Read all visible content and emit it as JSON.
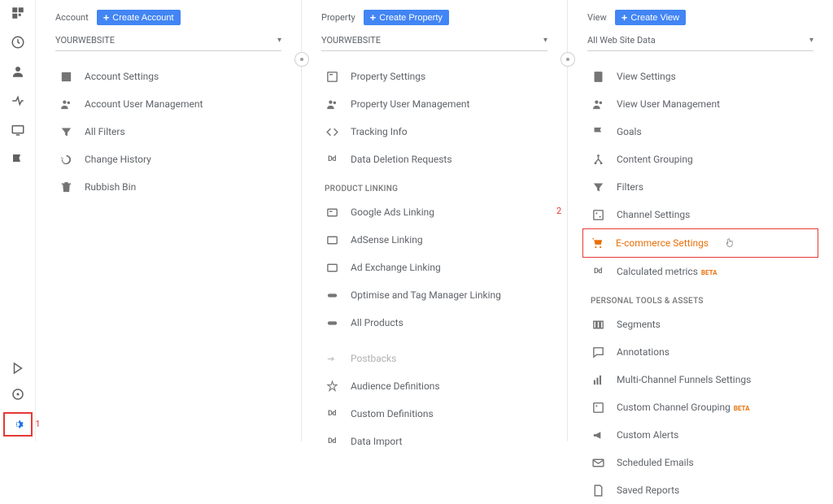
{
  "annotations": {
    "admin_gear": "1",
    "ecommerce": "2"
  },
  "sidebar_icons": [
    "home",
    "clock",
    "user",
    "arrows",
    "screen",
    "flag"
  ],
  "account": {
    "header_label": "Account",
    "create_btn": "Create Account",
    "selector": "YOURWEBSITE",
    "items": [
      {
        "label": "Account Settings"
      },
      {
        "label": "Account User Management"
      },
      {
        "label": "All Filters"
      },
      {
        "label": "Change History"
      },
      {
        "label": "Rubbish Bin"
      }
    ]
  },
  "property": {
    "header_label": "Property",
    "create_btn": "Create Property",
    "selector": "YOURWEBSITE",
    "items": [
      {
        "label": "Property Settings"
      },
      {
        "label": "Property User Management"
      },
      {
        "label": "Tracking Info"
      },
      {
        "label": "Data Deletion Requests"
      }
    ],
    "section_linking": "PRODUCT LINKING",
    "linking_items": [
      {
        "label": "Google Ads Linking"
      },
      {
        "label": "AdSense Linking"
      },
      {
        "label": "Ad Exchange Linking"
      },
      {
        "label": "Optimise and Tag Manager Linking"
      },
      {
        "label": "All Products"
      }
    ],
    "extra_items": [
      {
        "label": "Postbacks"
      },
      {
        "label": "Audience Definitions"
      },
      {
        "label": "Custom Definitions"
      },
      {
        "label": "Data Import"
      }
    ]
  },
  "view": {
    "header_label": "View",
    "create_btn": "Create View",
    "selector": "All Web Site Data",
    "items": [
      {
        "label": "View Settings"
      },
      {
        "label": "View User Management"
      },
      {
        "label": "Goals"
      },
      {
        "label": "Content Grouping"
      },
      {
        "label": "Filters"
      },
      {
        "label": "Channel Settings"
      }
    ],
    "ecommerce_label": "E-commerce Settings",
    "calc_label": "Calculated metrics",
    "calc_badge": "BETA",
    "section_personal": "PERSONAL TOOLS & ASSETS",
    "personal_items": [
      {
        "label": "Segments"
      },
      {
        "label": "Annotations"
      },
      {
        "label": "Multi-Channel Funnels Settings"
      },
      {
        "label": "Custom Channel Grouping",
        "badge": "BETA"
      },
      {
        "label": "Custom Alerts"
      },
      {
        "label": "Scheduled Emails"
      },
      {
        "label": "Saved Reports"
      }
    ]
  }
}
